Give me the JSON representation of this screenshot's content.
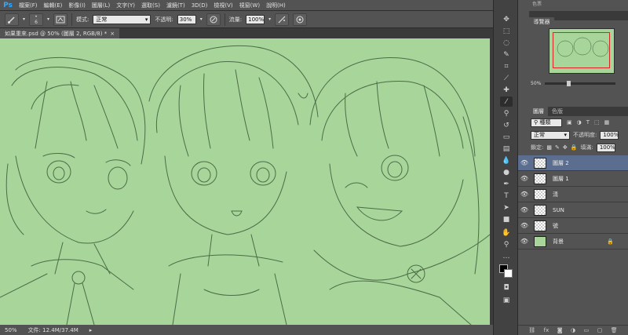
{
  "app": {
    "logo": "Ps"
  },
  "menu": [
    "檔案(F)",
    "編輯(E)",
    "影像(I)",
    "圖層(L)",
    "文字(Y)",
    "選取(S)",
    "濾鏡(T)",
    "3D(D)",
    "檢視(V)",
    "視窗(W)",
    "說明(H)"
  ],
  "window_controls": {
    "minimize": "─",
    "maximize": "□",
    "close": "✕"
  },
  "options": {
    "brush_size": "6",
    "mode_label": "模式:",
    "mode_value": "正常",
    "opacity_label": "不透明:",
    "opacity_value": "30%",
    "flow_label": "流量:",
    "flow_value": "100%"
  },
  "document": {
    "tab_label": "如果重來.psd @ 50% (圖層 2, RGB/8) *",
    "tab_close": "×"
  },
  "status": {
    "zoom": "50%",
    "file_info": "文件: 12.4M/37.4M"
  },
  "navigator": {
    "hidden_tab": "色票",
    "tab": "導覽器",
    "zoom": "50%"
  },
  "layers": {
    "tabs": [
      "圖層",
      "色版"
    ],
    "filter_kind": "種類",
    "blend_mode": "正常",
    "opacity_label": "不透明度:",
    "opacity_value": "100%",
    "lock_label": "鎖定:",
    "fill_label": "填滿:",
    "fill_value": "100%",
    "items": [
      {
        "name": "圖層 2",
        "selected": true,
        "thumb": "transparent"
      },
      {
        "name": "圖層 1",
        "selected": false,
        "thumb": "transparent"
      },
      {
        "name": "淸",
        "selected": false,
        "thumb": "transparent"
      },
      {
        "name": "SUN",
        "selected": false,
        "thumb": "transparent"
      },
      {
        "name": "號",
        "selected": false,
        "thumb": "transparent"
      },
      {
        "name": "背景",
        "selected": false,
        "thumb": "green",
        "locked": true
      }
    ]
  },
  "colors": {
    "canvas_bg": "#a7d59a",
    "ui_dark": "#535353",
    "nav_frame": "#e02424",
    "selected_layer": "#5b6e8f"
  }
}
